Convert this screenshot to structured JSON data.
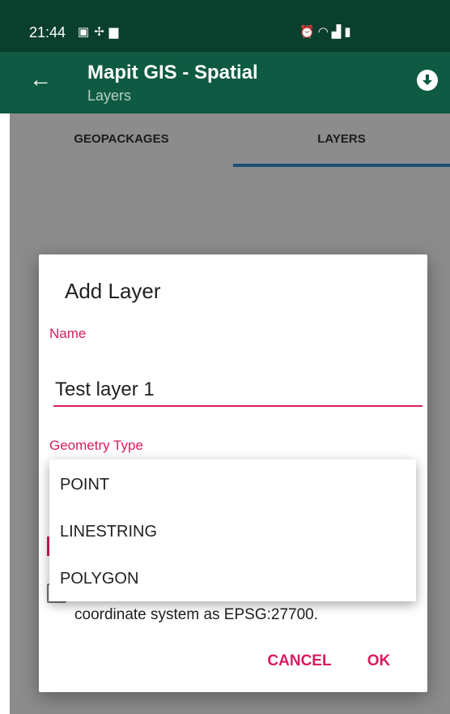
{
  "status_bar": {
    "time": "21:44",
    "left_icons": [
      "image-icon",
      "usb-icon",
      "sd-card-icon"
    ],
    "right_icons": [
      "alarm-icon",
      "wifi-icon",
      "signal-icon",
      "battery-icon"
    ]
  },
  "app_bar": {
    "title": "Mapit GIS - Spatial",
    "subtitle": "Layers",
    "colors": {
      "app_bar": "#0e5a42",
      "status_bar": "#0b3f2d"
    }
  },
  "tabs": [
    {
      "label": "GEOPACKAGES",
      "selected": false
    },
    {
      "label": "LAYERS",
      "selected": true
    }
  ],
  "dialog": {
    "title": "Add Layer",
    "name_label": "Name",
    "name_value": "Test layer 1",
    "geometry_label": "Geometry Type",
    "checkbox_text": "coordinate system as EPSG:27700.",
    "cancel_label": "CANCEL",
    "ok_label": "OK",
    "accent_color": "#d81b60"
  },
  "dropdown": {
    "options": [
      "POINT",
      "LINESTRING",
      "POLYGON"
    ]
  }
}
